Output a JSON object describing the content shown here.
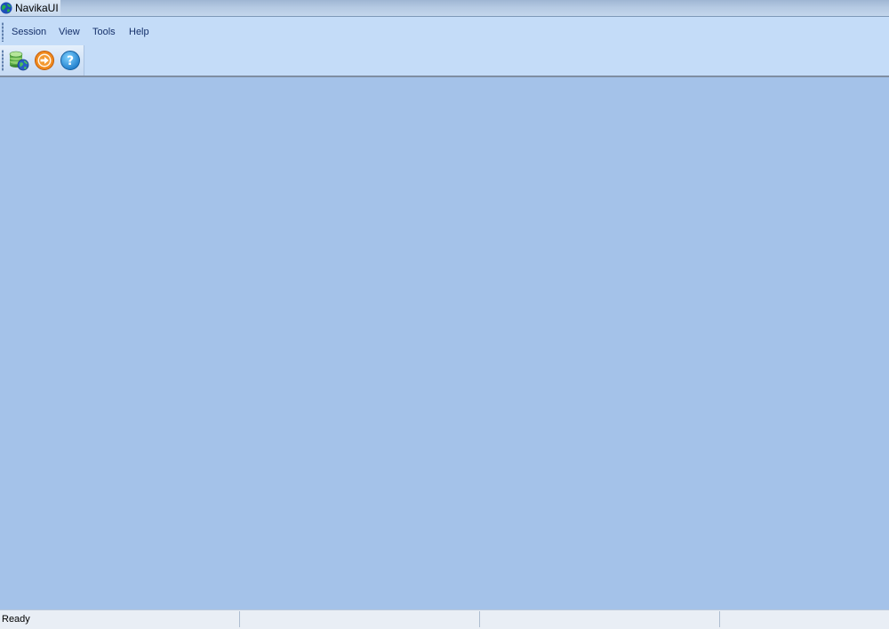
{
  "window": {
    "title": "NavikaUI",
    "background_color": "#a4c2e9"
  },
  "menu": {
    "items": [
      {
        "label": "Session"
      },
      {
        "label": "View"
      },
      {
        "label": "Tools"
      },
      {
        "label": "Help"
      }
    ]
  },
  "toolbar": {
    "buttons": [
      {
        "icon": "database-globe-icon"
      },
      {
        "icon": "exit-arrow-icon"
      },
      {
        "icon": "help-icon"
      }
    ]
  },
  "statusbar": {
    "panels": [
      {
        "text": "Ready"
      },
      {
        "text": ""
      },
      {
        "text": ""
      },
      {
        "text": ""
      }
    ]
  }
}
